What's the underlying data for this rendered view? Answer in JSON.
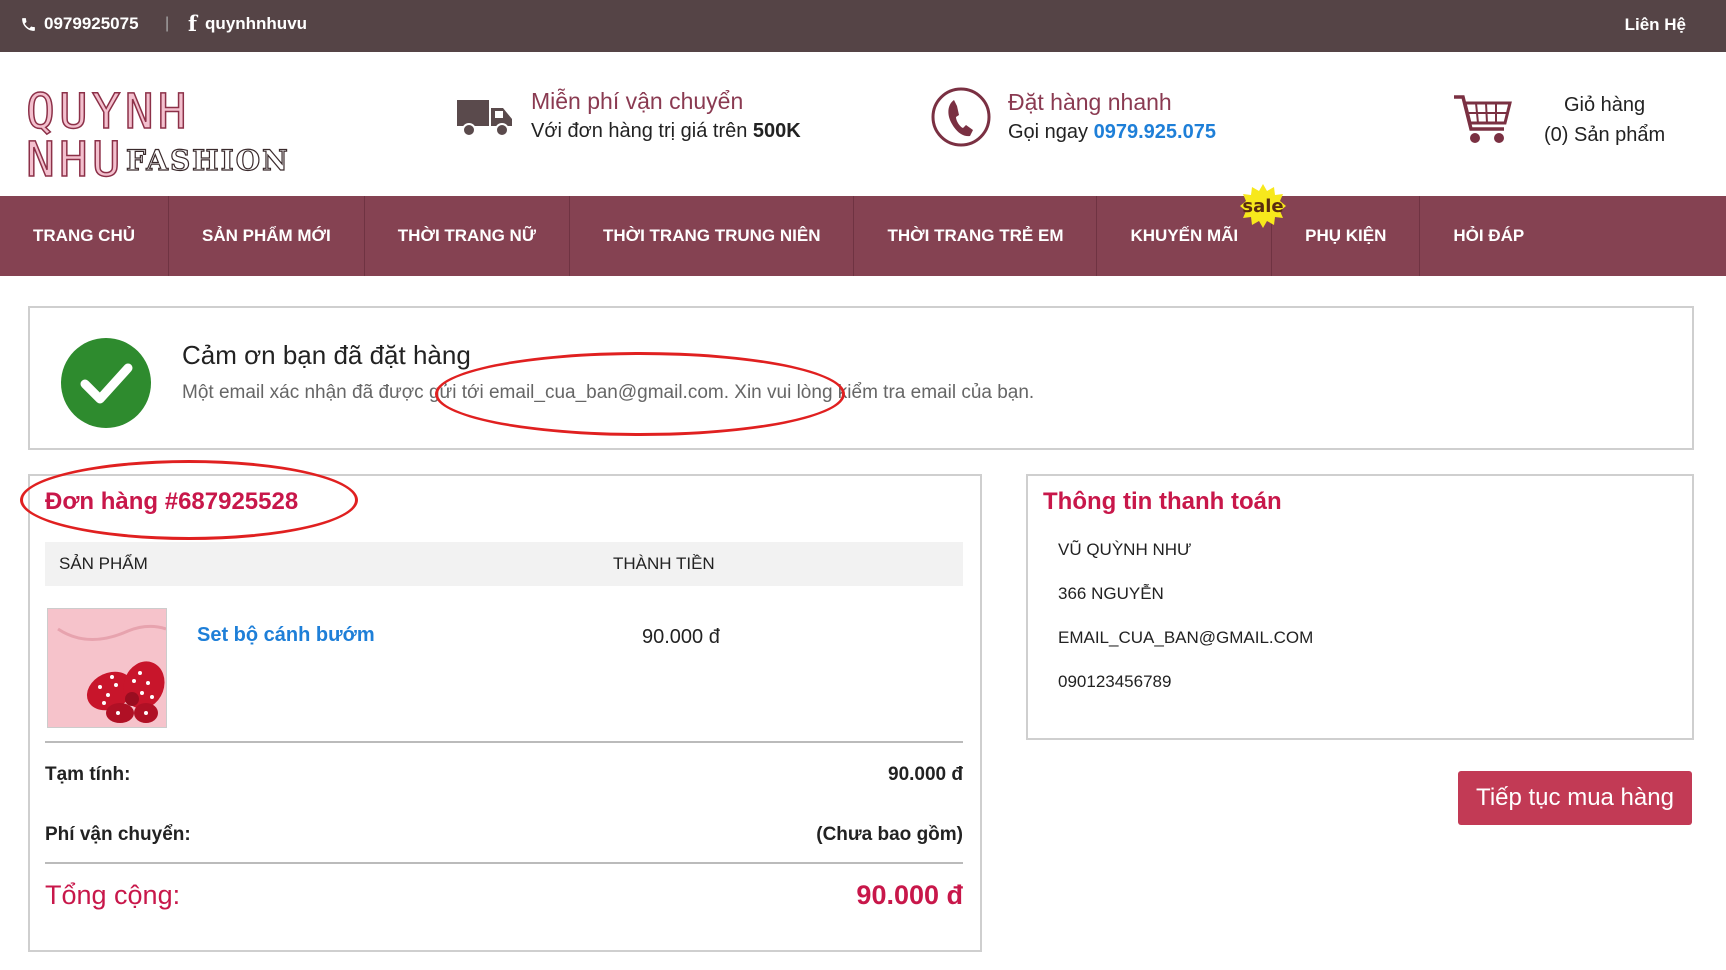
{
  "topbar": {
    "phone": "0979925075",
    "separator": "|",
    "facebook_icon_glyph": "f",
    "facebook": "quynhnhuvu",
    "contact": "Liên Hệ",
    "icons": [
      "phone-icon",
      "facebook-icon"
    ]
  },
  "logo": {
    "brand": "QUYNH NHU",
    "sub": "FASHION"
  },
  "features": {
    "shipping": {
      "title": "Miễn phí vận chuyển",
      "desc": "Với đơn hàng trị giá trên",
      "desc_bold": "500K",
      "icon": "truck-icon"
    },
    "order": {
      "title": "Đặt hàng nhanh",
      "desc": "Gọi ngay",
      "phone": "0979.925.075",
      "icon": "phone-circle-icon"
    }
  },
  "cart": {
    "label": "Giỏ hàng",
    "count_text": "(0) Sản phẩm",
    "icon": "cart-icon"
  },
  "nav": {
    "items": [
      "TRANG CHỦ",
      "SẢN PHẨM MỚI",
      "THỜI TRANG NỮ",
      "THỜI TRANG TRUNG NIÊN",
      "THỜI TRANG TRẺ EM",
      "KHUYẾN MÃI",
      "PHỤ KIỆN",
      "HỎI ĐÁP"
    ],
    "sale_badge": "sale"
  },
  "thanks": {
    "title": "Cảm ơn bạn đã đặt hàng",
    "message": "Một email xác nhận đã được gửi tới email_cua_ban@gmail.com. Xin vui lòng kiểm tra email của bạn."
  },
  "order": {
    "id_label": "Đơn hàng #687925528",
    "col_product": "SẢN PHẨM",
    "col_total": "THÀNH TIỀN",
    "items": [
      {
        "name": "Set bộ cánh bướm",
        "price": "90.000 đ"
      }
    ],
    "subtotal_label": "Tạm tính:",
    "subtotal_value": "90.000 đ",
    "shipping_label": "Phí vận chuyển:",
    "shipping_value": "(Chưa bao gồm)",
    "total_label": "Tổng cộng:",
    "total_value": "90.000 đ"
  },
  "payment": {
    "title": "Thông tin thanh toán",
    "name": "VŨ QUỲNH NHƯ",
    "address": "366 NGUYỄN",
    "email": "EMAIL_CUA_BAN@GMAIL.COM",
    "phone": "090123456789"
  },
  "continue_button": "Tiếp tục mua hàng",
  "colors": {
    "topbar": "#554446",
    "nav": "#854252",
    "accent_red": "#c8174a",
    "link_blue": "#1e7fd8",
    "button": "#c23a55",
    "annotation": "#e02020"
  }
}
